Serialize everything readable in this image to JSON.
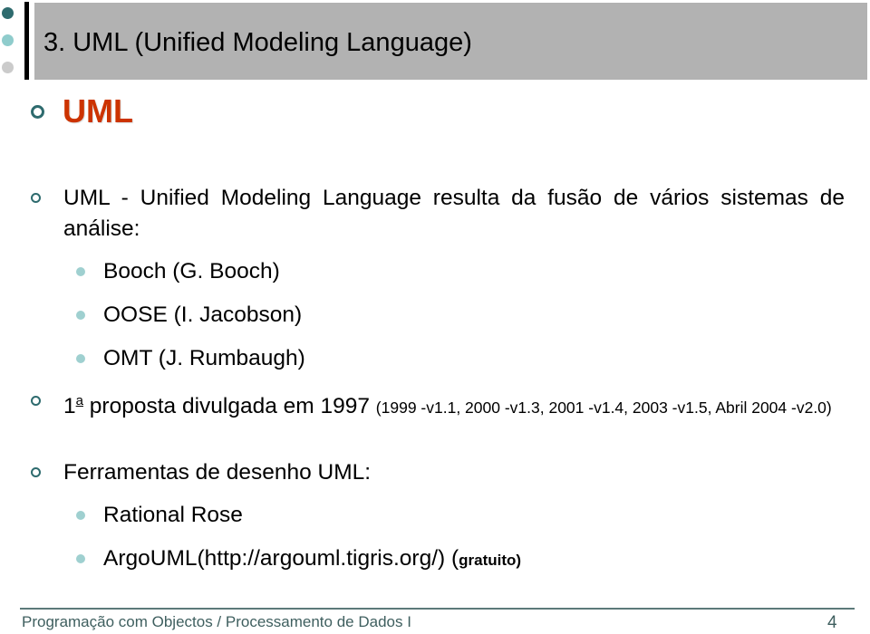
{
  "slide": {
    "title": "3. UML (Unified Modeling Language)",
    "heading": "UML",
    "colors": {
      "accent_dark_teal": "#2e6b6e",
      "accent_light_teal": "#8fcccc",
      "accent_gray": "#cbcbcb",
      "title_bar": "#b2b2b2",
      "heading": "#cc3300",
      "footer": "#3f5f5f"
    },
    "bullets": [
      {
        "text": "UML - Unified Modeling Language resulta da fusão de vários sistemas de análise:",
        "sub_items": [
          "Booch (G. Booch)",
          "OOSE (I. Jacobson)",
          "OMT (J. Rumbaugh)"
        ]
      },
      {
        "prefix": "1",
        "superscript": "a",
        "text": " proposta divulgada em 1997 ",
        "note": "(1999 -v1.1, 2000 -v1.3, 2001 -v1.4, 2003 -v1.5, Abril 2004 -v2.0)"
      },
      {
        "text": "Ferramentas de desenho UML:",
        "sub_items": [
          {
            "text": "Rational Rose"
          },
          {
            "text": "ArgoUML(http://argouml.tigris.org/) (",
            "bold": "gratuito",
            "suffix": ")"
          }
        ]
      }
    ]
  },
  "footer": {
    "course": "Programação com Objectos / Processamento de Dados I",
    "page_number": "4"
  },
  "icons": {
    "bullet_level1": "ring-bullet-icon",
    "bullet_level2": "filled-dot-icon",
    "decoration": "decorative-dots-icon"
  }
}
